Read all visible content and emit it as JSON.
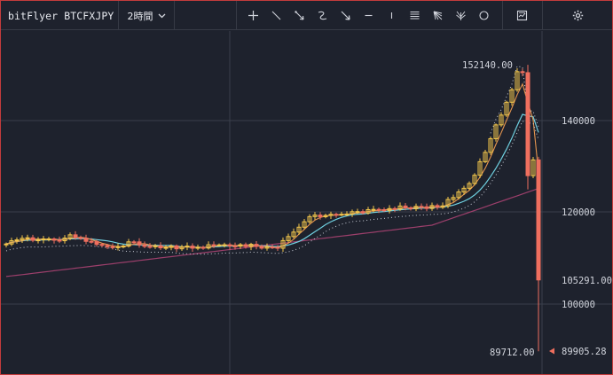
{
  "toolbar": {
    "symbol": "bitFlyer BTCFXJPY",
    "interval": "2時間",
    "tools": [
      {
        "name": "crosshair-icon"
      },
      {
        "name": "trend-line-icon"
      },
      {
        "name": "ray-arrow-icon"
      },
      {
        "name": "curve-icon"
      },
      {
        "name": "arrow-down-icon"
      },
      {
        "name": "horizontal-line-icon"
      },
      {
        "name": "vertical-line-icon"
      },
      {
        "name": "fib-retracement-icon"
      },
      {
        "name": "gann-fan-icon"
      },
      {
        "name": "pitchfork-fan-icon"
      },
      {
        "name": "circle-icon"
      },
      {
        "name": "chart-snapshot-icon"
      },
      {
        "name": "settings-gear-icon"
      }
    ]
  },
  "axis": {
    "ticks": [
      "140000",
      "120000",
      "100000"
    ],
    "current_price": "105291.00",
    "low_marker": "89905.28",
    "high_label": "152140.00",
    "low_label": "89712.00"
  },
  "colors": {
    "background": "#1e222d",
    "grid": "#3a3f4b",
    "candle_up": "#f5c84c",
    "candle_down": "#ef6f5e",
    "ma_fast": "#e5954f",
    "ma_mid": "#6fd0e0",
    "ma_slow": "#9c3f6b",
    "band": "#c8ccd6",
    "frame": "#c43c3c"
  }
}
